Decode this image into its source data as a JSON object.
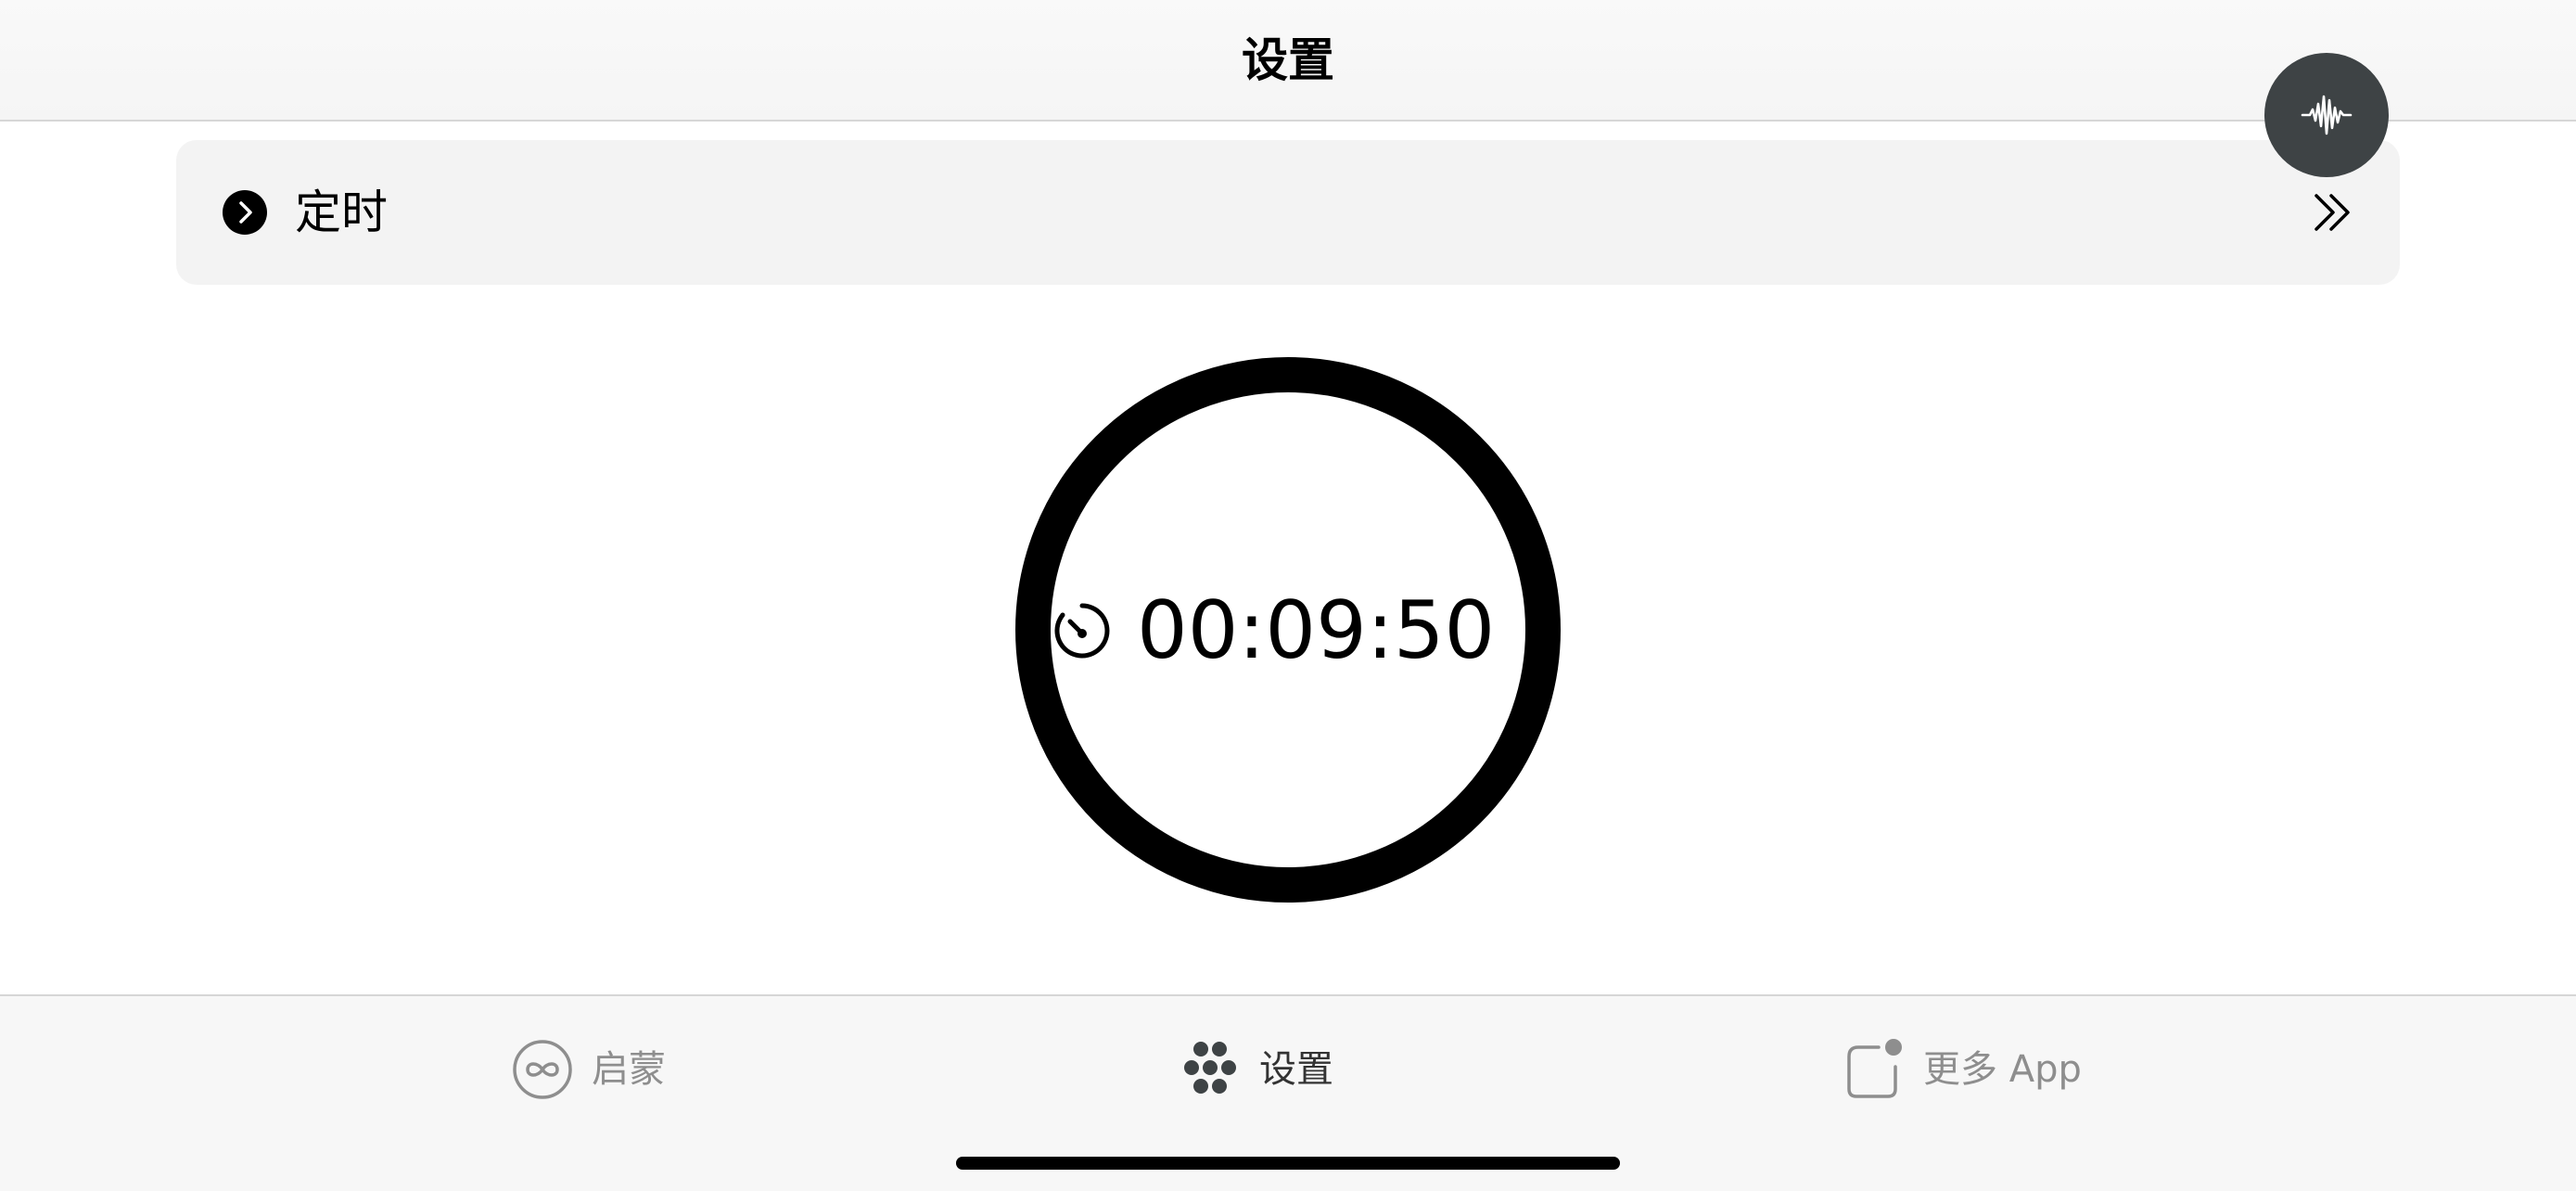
{
  "header": {
    "title": "设置"
  },
  "voice_button": {
    "icon": "waveform-icon"
  },
  "timer_row": {
    "icon": "chevron-right-circle-icon",
    "label": "定时",
    "trailing_icon": "double-chevron-right-icon"
  },
  "timer": {
    "icon": "timer-icon",
    "value": "00:09:50"
  },
  "tab_bar": {
    "tabs": [
      {
        "label": "启蒙",
        "icon": "infinity-icon",
        "active": false
      },
      {
        "label": "设置",
        "icon": "dots-cluster-icon",
        "active": true
      },
      {
        "label": "更多 App",
        "icon": "app-badge-icon",
        "active": false
      }
    ]
  },
  "colors": {
    "voice_button": "#3e4345",
    "row_background": "#f3f3f3",
    "ring": "#000000",
    "inactive_tab": "#8e8e8e"
  }
}
